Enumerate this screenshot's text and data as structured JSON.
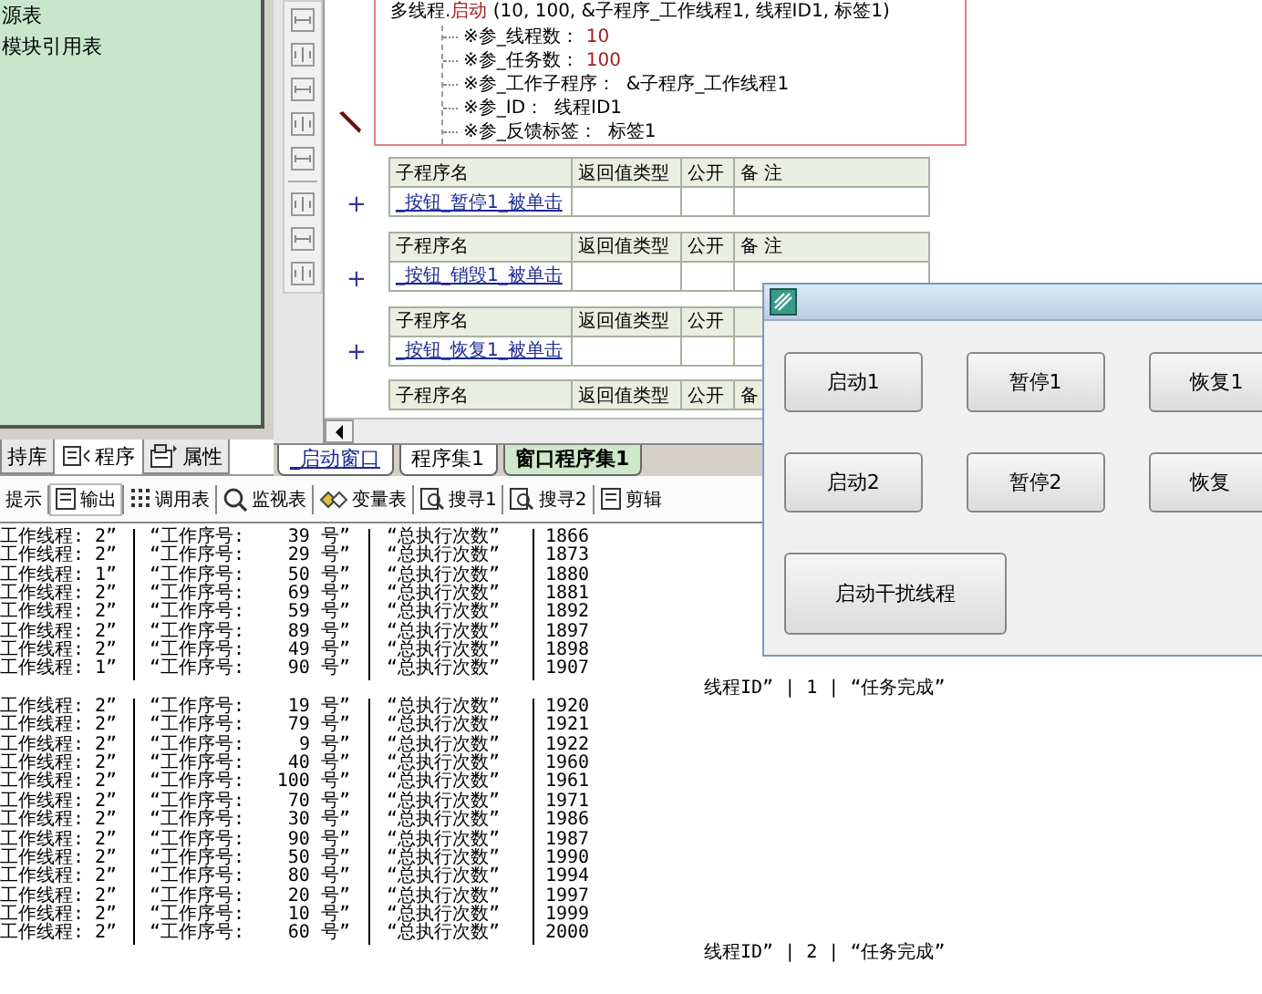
{
  "left_panel": {
    "items": [
      "源表",
      "模块引用表"
    ],
    "tabs": [
      {
        "label": "持库",
        "selected": false,
        "kind": "plain"
      },
      {
        "label": "程序",
        "selected": true,
        "kind": "program"
      },
      {
        "label": "属性",
        "selected": false,
        "kind": "property"
      }
    ]
  },
  "code_block": {
    "object": "多线程.",
    "method": "启动",
    "args": " (10, 100, &子程序_工作线程1, 线程ID1, 标签1)",
    "params": [
      {
        "name": "※参_线程数：",
        "value": "10",
        "kind": "number"
      },
      {
        "name": "※参_任务数：",
        "value": "100",
        "kind": "number"
      },
      {
        "name": "※参_工作子程序：",
        "value": "&子程序_工作线程1",
        "kind": "name"
      },
      {
        "name": "※参_ID：",
        "value": "线程ID1",
        "kind": "name"
      },
      {
        "name": "※参_反馈标签：",
        "value": "标签1",
        "kind": "name"
      }
    ]
  },
  "subroutines": [
    {
      "expander": "+",
      "columns": [
        "子程序名",
        "返回值类型",
        "公开",
        "备 注"
      ],
      "name": "_按钮_暂停1_被单击"
    },
    {
      "expander": "+",
      "columns": [
        "子程序名",
        "返回值类型",
        "公开",
        "备 注"
      ],
      "name": "_按钮_销毁1_被单击"
    },
    {
      "expander": "+",
      "columns": [
        "子程序名",
        "返回值类型",
        "公开"
      ],
      "name": "_按钮_恢复1_被单击"
    },
    {
      "columns": [
        "子程序名",
        "返回值类型",
        "公开",
        "备"
      ]
    }
  ],
  "editor_tabs": [
    {
      "label": "_启动窗口",
      "selected": false,
      "kind": "window"
    },
    {
      "label": "程序集1",
      "selected": false,
      "kind": "code"
    },
    {
      "label": "窗口程序集1",
      "selected": true,
      "kind": "code"
    }
  ],
  "form_window": {
    "button_rows": [
      [
        {
          "label": "启动1",
          "kind": "normal"
        },
        {
          "label": "暂停1",
          "kind": "normal"
        },
        {
          "label": "恢复1",
          "kind": "normal"
        }
      ],
      [
        {
          "label": "启动2",
          "kind": "normal"
        },
        {
          "label": "暂停2",
          "kind": "normal"
        },
        {
          "label": "恢复",
          "kind": "normal"
        }
      ],
      [
        {
          "label": "启动干扰线程",
          "kind": "wide"
        }
      ]
    ]
  },
  "output_toolbar": [
    {
      "label": "提示",
      "selected": false,
      "kind": "none"
    },
    {
      "label": "输出",
      "selected": true,
      "kind": "doc"
    },
    {
      "label": "调用表",
      "selected": false,
      "kind": "dots"
    },
    {
      "label": "监视表",
      "selected": false,
      "kind": "search"
    },
    {
      "label": "变量表",
      "selected": false,
      "kind": "vars"
    },
    {
      "label": "搜寻1",
      "selected": false,
      "kind": "find"
    },
    {
      "label": "搜寻2",
      "selected": false,
      "kind": "find"
    },
    {
      "label": "剪辑",
      "selected": false,
      "kind": "doc"
    }
  ],
  "output": {
    "lines": [
      {
        "kind": "row",
        "cells": [
          "工作线程: 2”",
          "“工作序号:",
          "39 号”",
          "“总执行次数”",
          "1866"
        ]
      },
      {
        "kind": "row",
        "cells": [
          "工作线程: 2”",
          "“工作序号:",
          "29 号”",
          "“总执行次数”",
          "1873"
        ]
      },
      {
        "kind": "row",
        "cells": [
          "工作线程: 1”",
          "“工作序号:",
          "50 号”",
          "“总执行次数”",
          "1880"
        ]
      },
      {
        "kind": "row",
        "cells": [
          "工作线程: 2”",
          "“工作序号:",
          "69 号”",
          "“总执行次数”",
          "1881"
        ]
      },
      {
        "kind": "row",
        "cells": [
          "工作线程: 2”",
          "“工作序号:",
          "59 号”",
          "“总执行次数”",
          "1892"
        ]
      },
      {
        "kind": "row",
        "cells": [
          "工作线程: 2”",
          "“工作序号:",
          "89 号”",
          "“总执行次数”",
          "1897"
        ]
      },
      {
        "kind": "row",
        "cells": [
          "工作线程: 2”",
          "“工作序号:",
          "49 号”",
          "“总执行次数”",
          "1898"
        ]
      },
      {
        "kind": "row",
        "cells": [
          "工作线程: 1”",
          "“工作序号:",
          "90 号”",
          "“总执行次数”",
          "1907"
        ]
      },
      {
        "kind": "tail",
        "text": "线程ID” | 1 | “任务完成”"
      },
      {
        "kind": "row",
        "cells": [
          "工作线程: 2”",
          "“工作序号:",
          "19 号”",
          "“总执行次数”",
          "1920"
        ]
      },
      {
        "kind": "row",
        "cells": [
          "工作线程: 2”",
          "“工作序号:",
          "79 号”",
          "“总执行次数”",
          "1921"
        ]
      },
      {
        "kind": "row",
        "cells": [
          "工作线程: 2”",
          "“工作序号:",
          "9 号”",
          "“总执行次数”",
          "1922"
        ]
      },
      {
        "kind": "row",
        "cells": [
          "工作线程: 2”",
          "“工作序号:",
          "40 号”",
          "“总执行次数”",
          "1960"
        ]
      },
      {
        "kind": "row",
        "cells": [
          "工作线程: 2”",
          "“工作序号:",
          "100 号”",
          "“总执行次数”",
          "1961"
        ]
      },
      {
        "kind": "row",
        "cells": [
          "工作线程: 2”",
          "“工作序号:",
          "70 号”",
          "“总执行次数”",
          "1971"
        ]
      },
      {
        "kind": "row",
        "cells": [
          "工作线程: 2”",
          "“工作序号:",
          "30 号”",
          "“总执行次数”",
          "1986"
        ]
      },
      {
        "kind": "row",
        "cells": [
          "工作线程: 2”",
          "“工作序号:",
          "90 号”",
          "“总执行次数”",
          "1987"
        ]
      },
      {
        "kind": "row",
        "cells": [
          "工作线程: 2”",
          "“工作序号:",
          "50 号”",
          "“总执行次数”",
          "1990"
        ]
      },
      {
        "kind": "row",
        "cells": [
          "工作线程: 2”",
          "“工作序号:",
          "80 号”",
          "“总执行次数”",
          "1994"
        ]
      },
      {
        "kind": "row",
        "cells": [
          "工作线程: 2”",
          "“工作序号:",
          "20 号”",
          "“总执行次数”",
          "1997"
        ]
      },
      {
        "kind": "row",
        "cells": [
          "工作线程: 2”",
          "“工作序号:",
          "10 号”",
          "“总执行次数”",
          "1999"
        ]
      },
      {
        "kind": "row",
        "cells": [
          "工作线程: 2”",
          "“工作序号:",
          "60 号”",
          "“总执行次数”",
          "2000"
        ]
      },
      {
        "kind": "tail",
        "text": "线程ID” | 2 | “任务完成”"
      }
    ]
  }
}
